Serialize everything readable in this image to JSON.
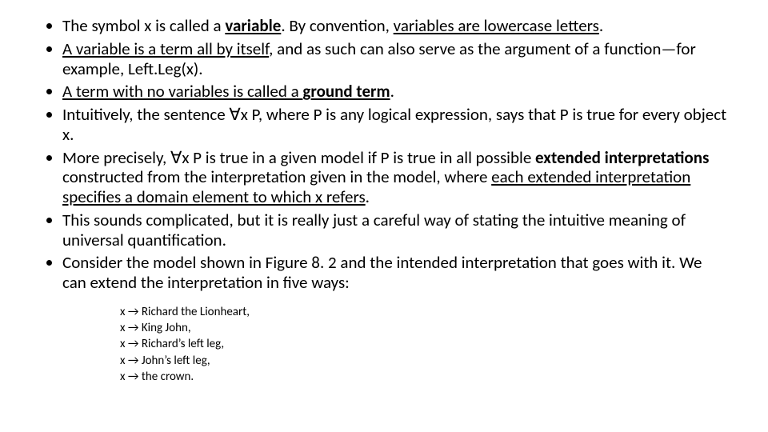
{
  "bullets": {
    "b1": {
      "t1": "The symbol x is called a ",
      "t2": "variable",
      "t3": ". By convention, ",
      "t4": "variables are lowercase letters",
      "t5": "."
    },
    "b2": {
      "t1": "A variable is a term all by itself",
      "t2": ", and as such can also serve as the argument of a function—for example, Left.Leg(x)."
    },
    "b3": {
      "t1": "A term with no variables is called a ",
      "t2": "ground term",
      "t3": "."
    },
    "b4": {
      "t1": "Intuitively, the sentence ∀x P, where P is any logical expression, says that P is true for every object x."
    },
    "b5": {
      "t1": "More precisely, ∀x P is true in a given model if P is true in all possible ",
      "t2": "extended interpretations",
      "t3": " constructed from the interpretation given in the model, where ",
      "t4": "each extended interpretation specifies a domain element to which x refers",
      "t5": "."
    },
    "b6": {
      "t1": "This sounds complicated, but it is really just a careful way of stating the intuitive meaning of universal quantification."
    },
    "b7": {
      "t1": "Consider the model shown in Figure 8. 2 and the intended interpretation that goes with it. We can extend the interpretation in five ways:"
    }
  },
  "mappings": {
    "m1": "x → Richard the Lionheart,",
    "m2": "x → King John,",
    "m3": "x → Richard’s left leg,",
    "m4": "x → John’s left leg,",
    "m5": "x → the crown."
  }
}
